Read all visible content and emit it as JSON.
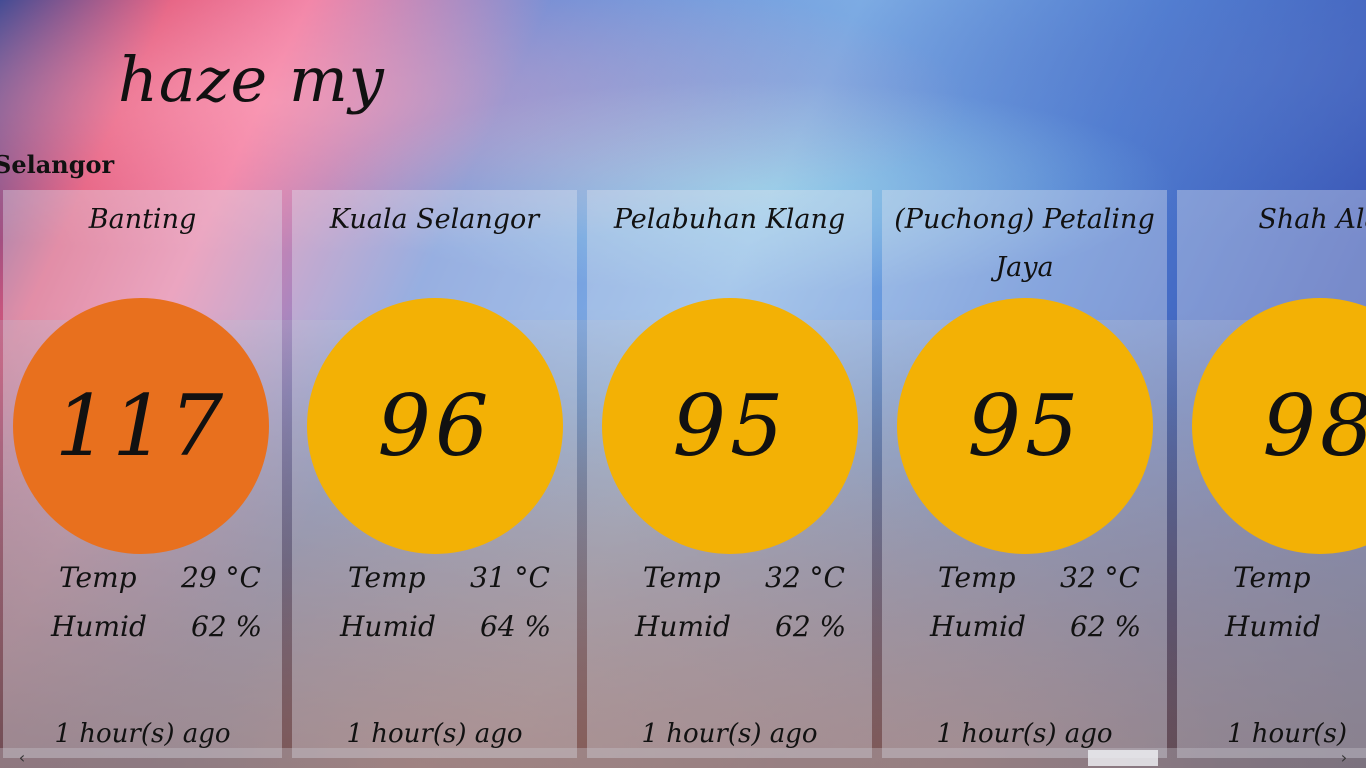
{
  "app": {
    "title": "haze my",
    "region": "Selangor"
  },
  "colors": {
    "unhealthy": "#E8701E",
    "moderate": "#F3B105"
  },
  "stations": [
    {
      "name": "Banting",
      "aqi": "117",
      "color": "#E8701E",
      "temp_label": "Temp",
      "temp": "29 °C",
      "humid_label": "Humid",
      "humid": "62 %",
      "updated": "1 hour(s) ago"
    },
    {
      "name": "Kuala Selangor",
      "aqi": "96",
      "color": "#F3B105",
      "temp_label": "Temp",
      "temp": "31 °C",
      "humid_label": "Humid",
      "humid": "64 %",
      "updated": "1 hour(s) ago"
    },
    {
      "name": "Pelabuhan Klang",
      "aqi": "95",
      "color": "#F3B105",
      "temp_label": "Temp",
      "temp": "32 °C",
      "humid_label": "Humid",
      "humid": "62 %",
      "updated": "1 hour(s) ago"
    },
    {
      "name": "(Puchong) Petaling Jaya",
      "aqi": "95",
      "color": "#F3B105",
      "temp_label": "Temp",
      "temp": "32 °C",
      "humid_label": "Humid",
      "humid": "62 %",
      "updated": "1 hour(s) ago"
    },
    {
      "name": "Shah Ala",
      "aqi": "98",
      "color": "#F3B105",
      "temp_label": "Temp",
      "temp": "",
      "humid_label": "Humid",
      "humid": "",
      "updated": "1 hour(s)"
    }
  ],
  "scrollbar": {
    "left_icon": "chevron-left-icon",
    "right_icon": "chevron-right-icon"
  }
}
